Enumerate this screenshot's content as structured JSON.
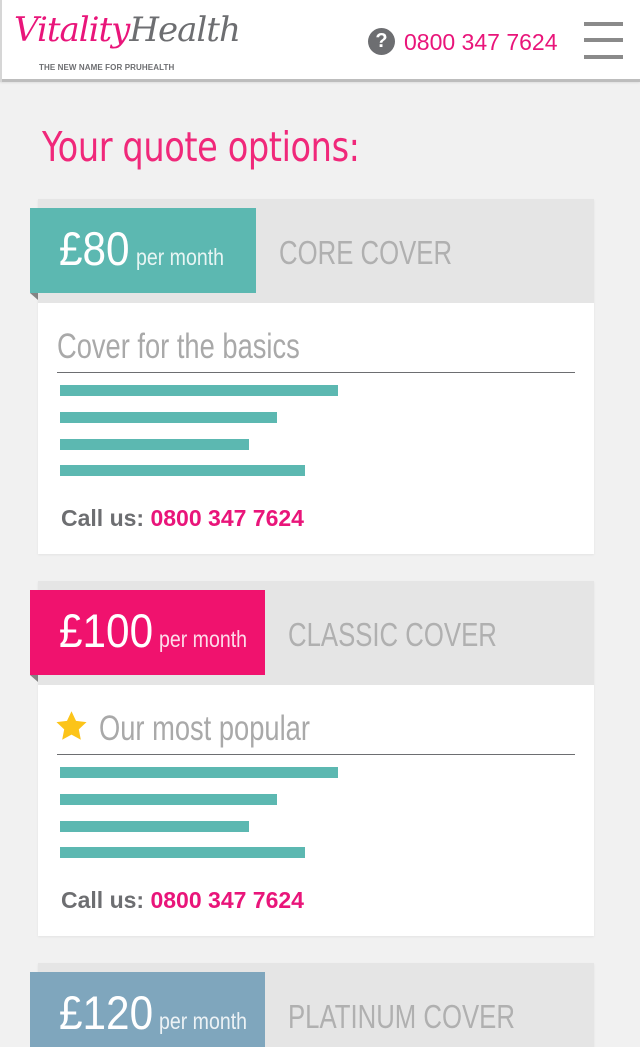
{
  "header": {
    "logo": {
      "brand_first": "Vitality",
      "brand_second": "Health",
      "tagline": "THE NEW NAME FOR PRUHEALTH"
    },
    "help_icon": "question-icon",
    "phone": "0800 347 7624",
    "menu_icon": "hamburger-menu-icon"
  },
  "page": {
    "title": "Your quote options:"
  },
  "colors": {
    "brand_pink": "#e9157a",
    "teal": "#5cb8b1",
    "blue_grey": "#7fa6bd",
    "grey_text": "#6d6e71",
    "star": "#fcc419"
  },
  "plans": [
    {
      "price": "£80",
      "period": "per month",
      "name": "CORE COVER",
      "subtitle": "Cover for the basics",
      "has_star": false,
      "feature_bars": [
        0.5,
        0.39,
        0.34,
        0.44
      ],
      "call_label": "Call us:",
      "call_number": "0800 347 7624"
    },
    {
      "price": "£100",
      "period": "per month",
      "name": "CLASSIC COVER",
      "subtitle": "Our most popular",
      "has_star": true,
      "feature_bars": [
        0.5,
        0.39,
        0.34,
        0.44
      ],
      "call_label": "Call us:",
      "call_number": "0800 347 7624"
    },
    {
      "price": "£120",
      "period": "per month",
      "name": "PLATINUM COVER"
    }
  ]
}
